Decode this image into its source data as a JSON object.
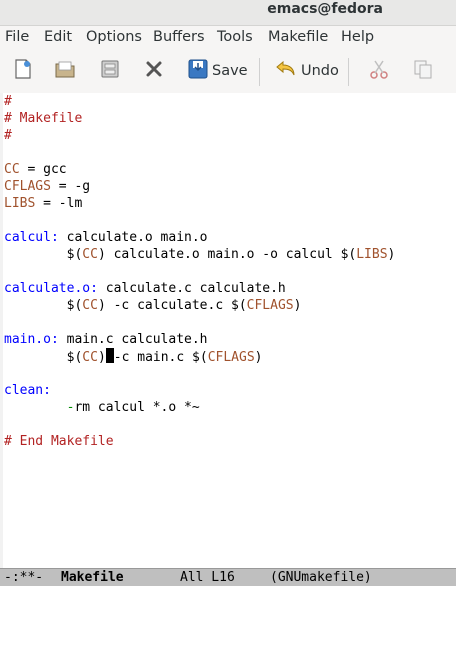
{
  "window": {
    "title": "emacs@fedora"
  },
  "menu": [
    "File",
    "Edit",
    "Options",
    "Buffers",
    "Tools",
    "Makefile",
    "Help"
  ],
  "toolbar": {
    "save_label": "Save",
    "undo_label": "Undo"
  },
  "code": {
    "l1": "#",
    "l2": "# Makefile",
    "l3": "#",
    "cc_name": "CC",
    "cc_val": " = gcc",
    "cflags_name": "CFLAGS",
    "cflags_val": " = -g",
    "libs_name": "LIBS",
    "libs_val": " = -lm",
    "calcul_target": "calcul:",
    "calcul_deps": " calculate.o main.o",
    "calcul_cmd_a": "        $(",
    "calcul_cmd_cc": "CC",
    "calcul_cmd_b": ") calculate.o main.o -o calcul $(",
    "calcul_cmd_libs": "LIBS",
    "calcul_cmd_c": ")",
    "calco_target": "calculate.o:",
    "calco_deps": " calculate.c calculate.h",
    "calco_cmd_a": "        $(",
    "calco_cmd_cc": "CC",
    "calco_cmd_b": ") -c calculate.c $(",
    "calco_cmd_cflags": "CFLAGS",
    "calco_cmd_c": ")",
    "maino_target": "main.o:",
    "maino_deps": " main.c calculate.h",
    "maino_cmd_a": "        $(",
    "maino_cmd_cc": "CC",
    "maino_cmd_b": ")",
    "maino_cmd_c": "-c main.c $(",
    "maino_cmd_cflags": "CFLAGS",
    "maino_cmd_d": ")",
    "clean_target": "clean:",
    "clean_cmd_indent": "        ",
    "clean_cmd_dash": "-",
    "clean_cmd_rest": "rm calcul *.o *~",
    "end": "# End Makefile"
  },
  "modeline": {
    "status": "-:**-",
    "buffer": "Makefile",
    "position": "All L16",
    "mode": "(GNUmakefile)"
  },
  "colors": {
    "comment": "#b22222",
    "variable": "#a0522d",
    "target": "#0000ff",
    "command": "#008b00"
  }
}
